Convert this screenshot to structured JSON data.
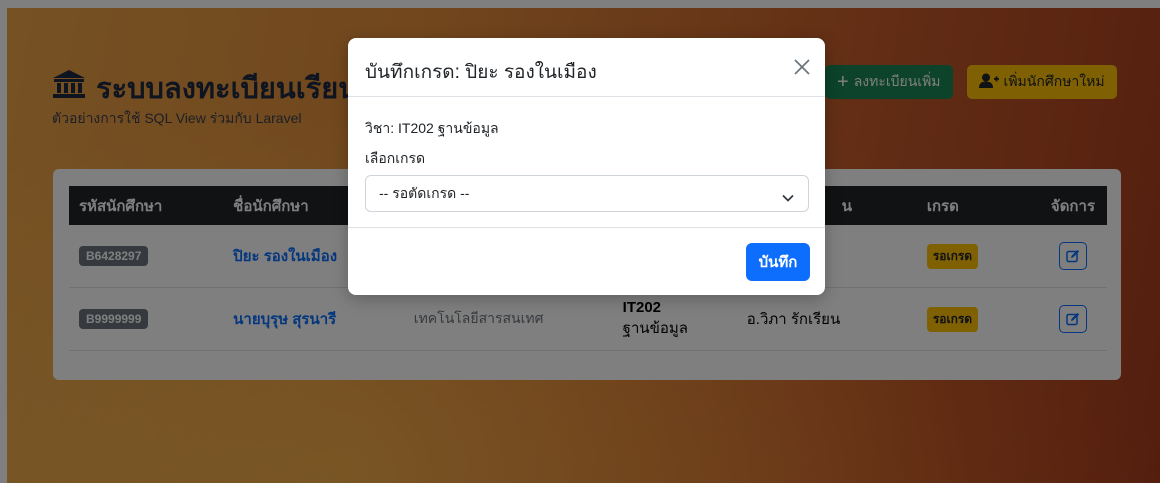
{
  "app": {
    "title": "ระบบลงทะเบียนเรียน",
    "subtitle": "ตัวอย่างการใช้ SQL View ร่วมกับ Laravel",
    "icon": "bank-icon"
  },
  "toolbar": {
    "enroll_label": "ลงทะเบียนเพิ่ม",
    "add_student_label": "เพิ่มนักศึกษาใหม่",
    "colors": {
      "enroll": "#198754",
      "add_student": "#ffc107"
    }
  },
  "table": {
    "headers": {
      "student_id": "รหัสนักศึกษา",
      "student_name": "ชื่อนักศึกษา",
      "instructor": "น",
      "grade": "เกรด",
      "manage": "จัดการ"
    },
    "rows": [
      {
        "student_id": "B6428297",
        "student_name": "ปิยะ รองในเมือง",
        "faculty": "",
        "course_code": "",
        "course_name": "",
        "instructor": "",
        "grade": "รอเกรด"
      },
      {
        "student_id": "B9999999",
        "student_name": "นายบุรุษ สุรนารี",
        "faculty": "เทคโนโลยีสารสนเทศ",
        "course_code": "IT202",
        "course_name": "ฐานข้อมูล",
        "instructor": "อ.วิภา รักเรียน",
        "grade": "รอเกรด"
      }
    ]
  },
  "modal": {
    "title": "บันทึกเกรด: ปิยะ รองในเมือง",
    "course_line": "วิชา: IT202 ฐานข้อมูล",
    "select_label": "เลือกเกรด",
    "select_value": "-- รอตัดเกรด --",
    "save_label": "บันทึก",
    "colors": {
      "save": "#0d6efd"
    }
  }
}
